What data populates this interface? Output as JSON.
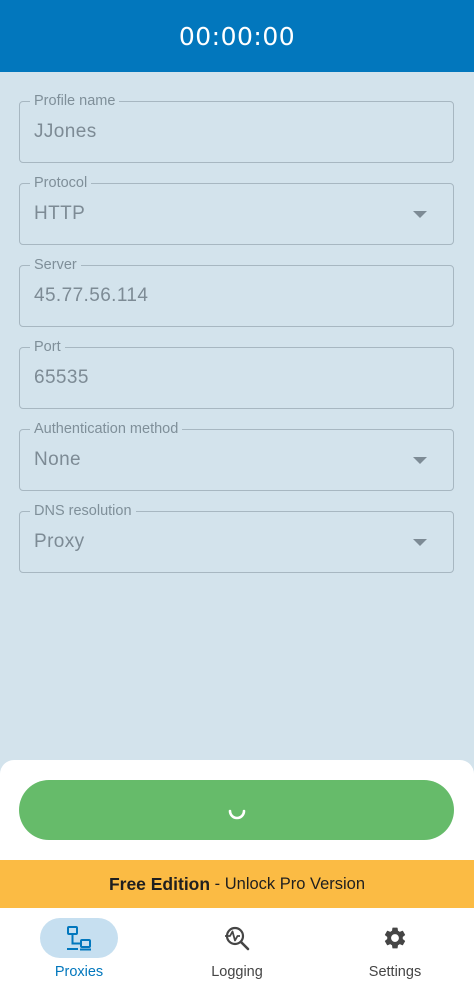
{
  "header": {
    "timer": "00:00:00"
  },
  "form": {
    "profile_name": {
      "label": "Profile name",
      "value": "JJones"
    },
    "protocol": {
      "label": "Protocol",
      "value": "HTTP"
    },
    "server": {
      "label": "Server",
      "value": "45.77.56.114"
    },
    "port": {
      "label": "Port",
      "value": "65535"
    },
    "auth_method": {
      "label": "Authentication method",
      "value": "None"
    },
    "dns_resolution": {
      "label": "DNS resolution",
      "value": "Proxy"
    }
  },
  "connect_button": {
    "state": "connecting",
    "color": "#66bb6a",
    "icon": "loading-spinner-icon"
  },
  "promo": {
    "bold": "Free Edition",
    "rest": " - Unlock Pro Version",
    "color": "#fbbb44"
  },
  "nav": {
    "proxies": {
      "label": "Proxies",
      "icon": "network-icon",
      "active": true
    },
    "logging": {
      "label": "Logging",
      "icon": "activity-search-icon",
      "active": false
    },
    "settings": {
      "label": "Settings",
      "icon": "gear-icon",
      "active": false
    }
  },
  "colors": {
    "primary": "#0277bd",
    "background": "#d3e3ec"
  }
}
